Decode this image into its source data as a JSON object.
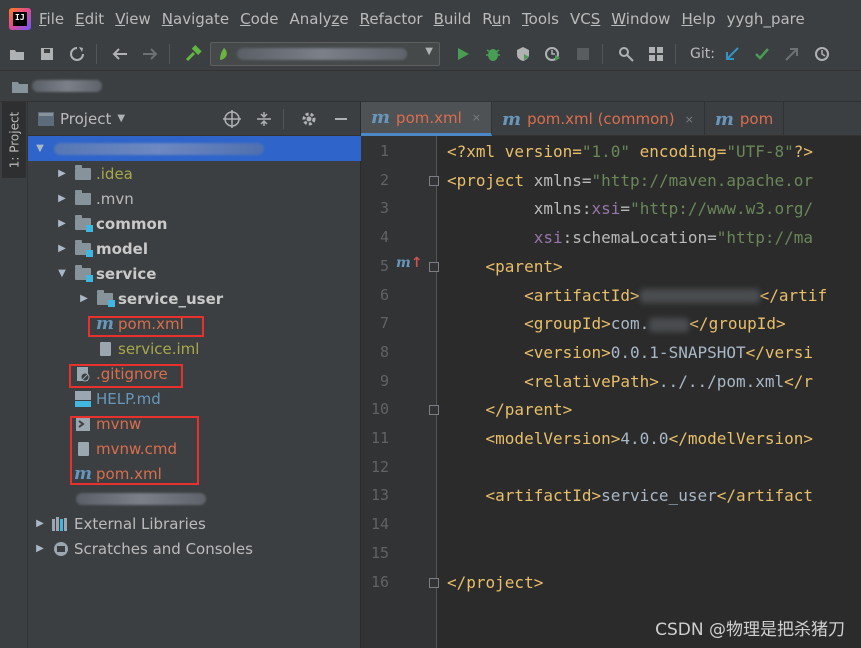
{
  "menu": [
    "File",
    "Edit",
    "View",
    "Navigate",
    "Code",
    "Analyze",
    "Refactor",
    "Build",
    "Run",
    "Tools",
    "VCS",
    "Window",
    "Help"
  ],
  "menu_mnemonics": [
    "F",
    "E",
    "V",
    "N",
    "C",
    "z",
    "R",
    "B",
    "u",
    "T",
    "S",
    "W",
    "H"
  ],
  "window_title": "yygh_pare",
  "toolbar": {
    "git_label": "Git:",
    "icons": [
      "open-icon",
      "save-icon",
      "sync-icon",
      "back-icon",
      "forward-icon",
      "build-hammer-icon",
      "run-icon",
      "debug-icon",
      "coverage-icon",
      "profile-icon",
      "stop-icon",
      "search-everywhere-icon",
      "window-icon",
      "git-update-icon",
      "git-commit-icon",
      "git-push-icon",
      "history-icon"
    ]
  },
  "strip": {
    "project_tab": "1: Project"
  },
  "project_panel": {
    "title": "Project",
    "tree": [
      {
        "label": "",
        "kind": "root-blurred",
        "depth": 0,
        "expanded": true,
        "selected": true
      },
      {
        "label": ".idea",
        "kind": "folder",
        "depth": 1,
        "expanded": false,
        "color": "olive"
      },
      {
        "label": ".mvn",
        "kind": "folder",
        "depth": 1,
        "expanded": false,
        "color": "default"
      },
      {
        "label": "common",
        "kind": "module",
        "depth": 1,
        "expanded": false,
        "color": "bold"
      },
      {
        "label": "model",
        "kind": "module",
        "depth": 1,
        "expanded": false,
        "color": "bold"
      },
      {
        "label": "service",
        "kind": "module",
        "depth": 1,
        "expanded": true,
        "color": "bold"
      },
      {
        "label": "service_user",
        "kind": "module",
        "depth": 2,
        "expanded": false,
        "color": "bold"
      },
      {
        "label": "pom.xml",
        "kind": "maven",
        "depth": 2,
        "color": "orange"
      },
      {
        "label": "service.iml",
        "kind": "doc",
        "depth": 2,
        "color": "olive"
      },
      {
        "label": ".gitignore",
        "kind": "ignore",
        "depth": 1,
        "color": "orange"
      },
      {
        "label": "HELP.md",
        "kind": "md",
        "depth": 1,
        "color": "blue"
      },
      {
        "label": "mvnw",
        "kind": "shell",
        "depth": 1,
        "color": "orange"
      },
      {
        "label": "mvnw.cmd",
        "kind": "doc",
        "depth": 1,
        "color": "orange"
      },
      {
        "label": "pom.xml",
        "kind": "maven",
        "depth": 1,
        "color": "orange"
      },
      {
        "label": "",
        "kind": "blurred",
        "depth": 1
      },
      {
        "label": "External Libraries",
        "kind": "libs",
        "depth": 0,
        "expanded": false,
        "color": "default"
      },
      {
        "label": "Scratches and Consoles",
        "kind": "scratch",
        "depth": 0,
        "expanded": false,
        "color": "default"
      }
    ]
  },
  "editor": {
    "tabs": [
      {
        "label": "pom.xml",
        "active": true
      },
      {
        "label": "pom.xml (common)",
        "active": false
      },
      {
        "label": "pom",
        "active": false
      }
    ],
    "line_numbers": [
      "1",
      "2",
      "3",
      "4",
      "5",
      "6",
      "7",
      "8",
      "9",
      "10",
      "11",
      "12",
      "13",
      "14",
      "15",
      "16"
    ],
    "lines": [
      [
        {
          "t": "<?xml version=",
          "c": "pi"
        },
        {
          "t": "\"1.0\"",
          "c": "str"
        },
        {
          "t": " encoding=",
          "c": "pi"
        },
        {
          "t": "\"UTF-8\"",
          "c": "str"
        },
        {
          "t": "?>",
          "c": "pi"
        }
      ],
      [
        {
          "t": "<project ",
          "c": "tag"
        },
        {
          "t": "xmlns",
          "c": "attr"
        },
        {
          "t": "=",
          "c": "attr"
        },
        {
          "t": "\"http://maven.apache.or",
          "c": "str"
        }
      ],
      [
        {
          "t": "         ",
          "c": "attr"
        },
        {
          "t": "xmlns",
          "c": "attr"
        },
        {
          "t": ":",
          "c": "attr"
        },
        {
          "t": "xsi",
          "c": "ns"
        },
        {
          "t": "=",
          "c": "attr"
        },
        {
          "t": "\"http://www.w3.org/",
          "c": "str"
        }
      ],
      [
        {
          "t": "         ",
          "c": "attr"
        },
        {
          "t": "xsi",
          "c": "ns"
        },
        {
          "t": ":schemaLocation=",
          "c": "attr"
        },
        {
          "t": "\"http://ma",
          "c": "str"
        }
      ],
      [
        {
          "t": "    <parent>",
          "c": "tag"
        }
      ],
      [
        {
          "t": "        <artifactId>",
          "c": "tag"
        },
        {
          "t": "",
          "c": "blur"
        },
        {
          "t": "</artif",
          "c": "tag"
        }
      ],
      [
        {
          "t": "        <groupId>",
          "c": "tag"
        },
        {
          "t": "com.",
          "c": "text"
        },
        {
          "t": "",
          "c": "blur-sm"
        },
        {
          "t": "</groupId>",
          "c": "tag"
        }
      ],
      [
        {
          "t": "        <version>",
          "c": "tag"
        },
        {
          "t": "0.0.1-SNAPSHOT",
          "c": "text"
        },
        {
          "t": "</versi",
          "c": "tag"
        }
      ],
      [
        {
          "t": "        <relativePath>",
          "c": "tag"
        },
        {
          "t": "../../pom.xml",
          "c": "text"
        },
        {
          "t": "</r",
          "c": "tag"
        }
      ],
      [
        {
          "t": "    </parent>",
          "c": "tag"
        }
      ],
      [
        {
          "t": "    <modelVersion>",
          "c": "tag"
        },
        {
          "t": "4.0.0",
          "c": "text"
        },
        {
          "t": "</modelVersion>",
          "c": "tag"
        }
      ],
      [],
      [
        {
          "t": "    <artifactId>",
          "c": "tag"
        },
        {
          "t": "service_user",
          "c": "text"
        },
        {
          "t": "</artifact",
          "c": "tag"
        }
      ],
      [],
      [],
      [
        {
          "t": "</project>",
          "c": "tag"
        }
      ]
    ]
  },
  "watermark": "CSDN @物理是把杀猪刀",
  "colors": {
    "accent": "#2f65ca",
    "highlight_box": "#e8302c",
    "modified_file": "#d86e4e"
  }
}
